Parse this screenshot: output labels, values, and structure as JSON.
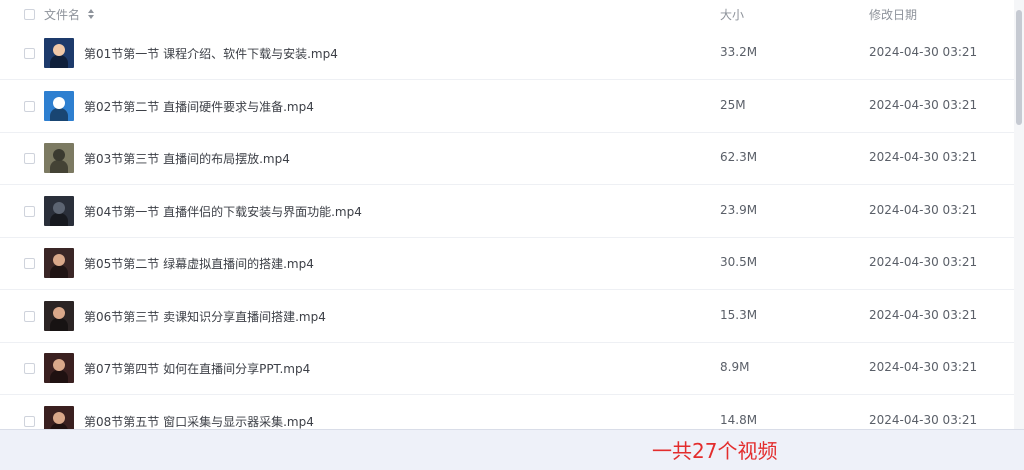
{
  "header": {
    "name_label": "文件名",
    "size_label": "大小",
    "date_label": "修改日期"
  },
  "files": [
    {
      "name": "第01节第一节 课程介绍、软件下载与安装.mp4",
      "size": "33.2M",
      "date": "2024-04-30 03:21",
      "thumb_bg": "#1d3a6b",
      "thumb_fig": "#f0c8a8"
    },
    {
      "name": "第02节第二节 直播间硬件要求与准备.mp4",
      "size": "25M",
      "date": "2024-04-30 03:21",
      "thumb_bg": "#2e7fd0",
      "thumb_fig": "#ffffff"
    },
    {
      "name": "第03节第三节 直播间的布局摆放.mp4",
      "size": "62.3M",
      "date": "2024-04-30 03:21",
      "thumb_bg": "#7c7a62",
      "thumb_fig": "#3a3a30"
    },
    {
      "name": "第04节第一节 直播伴侣的下载安装与界面功能.mp4",
      "size": "23.9M",
      "date": "2024-04-30 03:21",
      "thumb_bg": "#2a2f3a",
      "thumb_fig": "#5c6472"
    },
    {
      "name": "第05节第二节 绿幕虚拟直播间的搭建.mp4",
      "size": "30.5M",
      "date": "2024-04-30 03:21",
      "thumb_bg": "#3a2626",
      "thumb_fig": "#d9a88a"
    },
    {
      "name": "第06节第三节 卖课知识分享直播间搭建.mp4",
      "size": "15.3M",
      "date": "2024-04-30 03:21",
      "thumb_bg": "#2b2424",
      "thumb_fig": "#d9a88a"
    },
    {
      "name": "第07节第四节 如何在直播间分享PPT.mp4",
      "size": "8.9M",
      "date": "2024-04-30 03:21",
      "thumb_bg": "#3a2020",
      "thumb_fig": "#d9a88a"
    },
    {
      "name": "第08节第五节 窗口采集与显示器采集.mp4",
      "size": "14.8M",
      "date": "2024-04-30 03:21",
      "thumb_bg": "#3a2020",
      "thumb_fig": "#d9a88a"
    }
  ],
  "caption": "一共27个视频"
}
